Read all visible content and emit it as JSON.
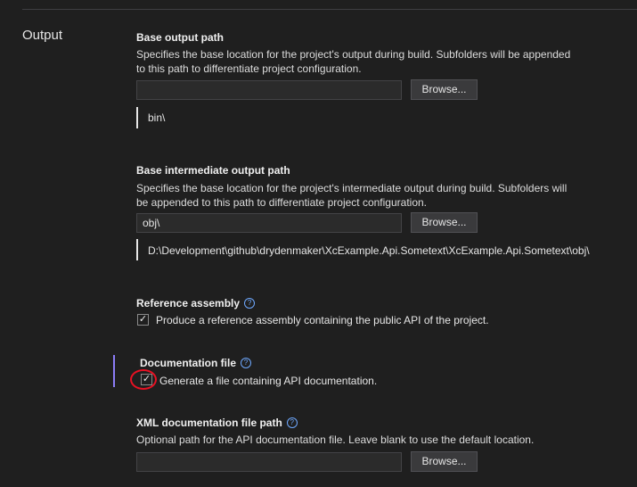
{
  "section": {
    "title": "Output"
  },
  "base_output": {
    "title": "Base output path",
    "desc": "Specifies the base location for the project's output during build. Subfolders will be appended to this path to differentiate project configuration.",
    "input_value": "",
    "browse_label": "Browse...",
    "evaluated": "bin\\"
  },
  "base_intermediate": {
    "title": "Base intermediate output path",
    "desc": "Specifies the base location for the project's intermediate output during build. Subfolders will be appended to this path to differentiate project configuration.",
    "input_value": "obj\\",
    "browse_label": "Browse...",
    "evaluated": "D:\\Development\\github\\drydenmaker\\XcExample.Api.Sometext\\XcExample.Api.Sometext\\obj\\"
  },
  "reference_assembly": {
    "title": "Reference assembly",
    "help": "?",
    "checked": true,
    "label": "Produce a reference assembly containing the public API of the project."
  },
  "documentation_file": {
    "title": "Documentation file",
    "help": "?",
    "checked": true,
    "label": "Generate a file containing API documentation."
  },
  "xml_doc_path": {
    "title": "XML documentation file path",
    "help": "?",
    "desc": "Optional path for the API documentation file. Leave blank to use the default location.",
    "input_value": "",
    "browse_label": "Browse..."
  },
  "colors": {
    "background": "#1f1f1f",
    "focus_bar": "#8b7cf6",
    "highlight_ring": "#e81123",
    "help_icon": "#6ea8fe"
  },
  "icons": {
    "check": "✓"
  }
}
